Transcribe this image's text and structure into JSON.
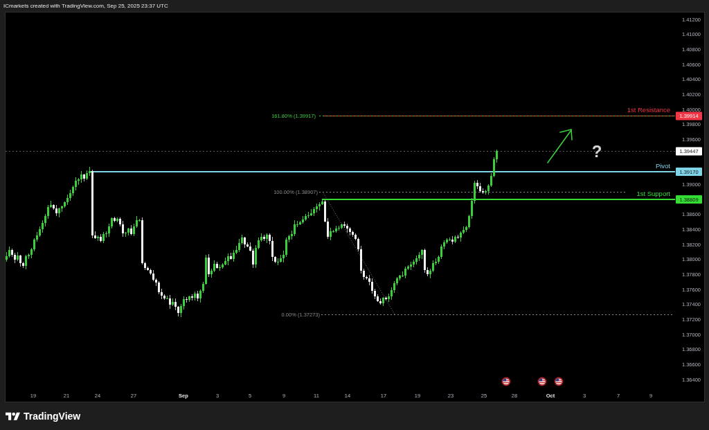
{
  "header": {
    "text": "ICmarkets created with TradingView.com, Sep 25, 2025 23:37 UTC"
  },
  "chart": {
    "levels": [
      {
        "name": "1st Resistance",
        "price": "1.39914",
        "color": "#f23645"
      },
      {
        "name": "Pivot",
        "price": "1.39170",
        "color": "#7fd4e8"
      },
      {
        "name": "1st Support",
        "price": "1.38809",
        "color": "#33dd33"
      }
    ],
    "fibonacci": [
      {
        "label": "161.80% (1.39917)",
        "color": "#3fcf3f"
      },
      {
        "label": "100.00% (1.38907)",
        "color": "#8c8c8c"
      },
      {
        "label": "0.00% (1.37273)",
        "color": "#8c8c8c"
      }
    ],
    "last_price": "1.39447",
    "annotation": "?",
    "price_axis": [
      "1.41200",
      "1.41000",
      "1.40800",
      "1.40600",
      "1.40400",
      "1.40200",
      "1.40000",
      "1.39800",
      "1.39600",
      "1.39000",
      "1.38600",
      "1.38400",
      "1.38200",
      "1.38000",
      "1.37800",
      "1.37600",
      "1.37400",
      "1.37200",
      "1.37000",
      "1.36800",
      "1.36600",
      "1.36400"
    ],
    "time_axis": [
      {
        "label": "19",
        "kind": "day"
      },
      {
        "label": "21",
        "kind": "day"
      },
      {
        "label": "24",
        "kind": "day"
      },
      {
        "label": "27",
        "kind": "day"
      },
      {
        "label": "Sep",
        "kind": "month"
      },
      {
        "label": "3",
        "kind": "day"
      },
      {
        "label": "5",
        "kind": "day"
      },
      {
        "label": "9",
        "kind": "day"
      },
      {
        "label": "11",
        "kind": "day"
      },
      {
        "label": "14",
        "kind": "day"
      },
      {
        "label": "17",
        "kind": "day"
      },
      {
        "label": "19",
        "kind": "day"
      },
      {
        "label": "23",
        "kind": "day"
      },
      {
        "label": "25",
        "kind": "day"
      },
      {
        "label": "28",
        "kind": "day"
      },
      {
        "label": "Oct",
        "kind": "month"
      },
      {
        "label": "3",
        "kind": "day"
      },
      {
        "label": "7",
        "kind": "day"
      },
      {
        "label": "9",
        "kind": "day"
      }
    ]
  },
  "footer": {
    "brand": "TradingView"
  }
}
